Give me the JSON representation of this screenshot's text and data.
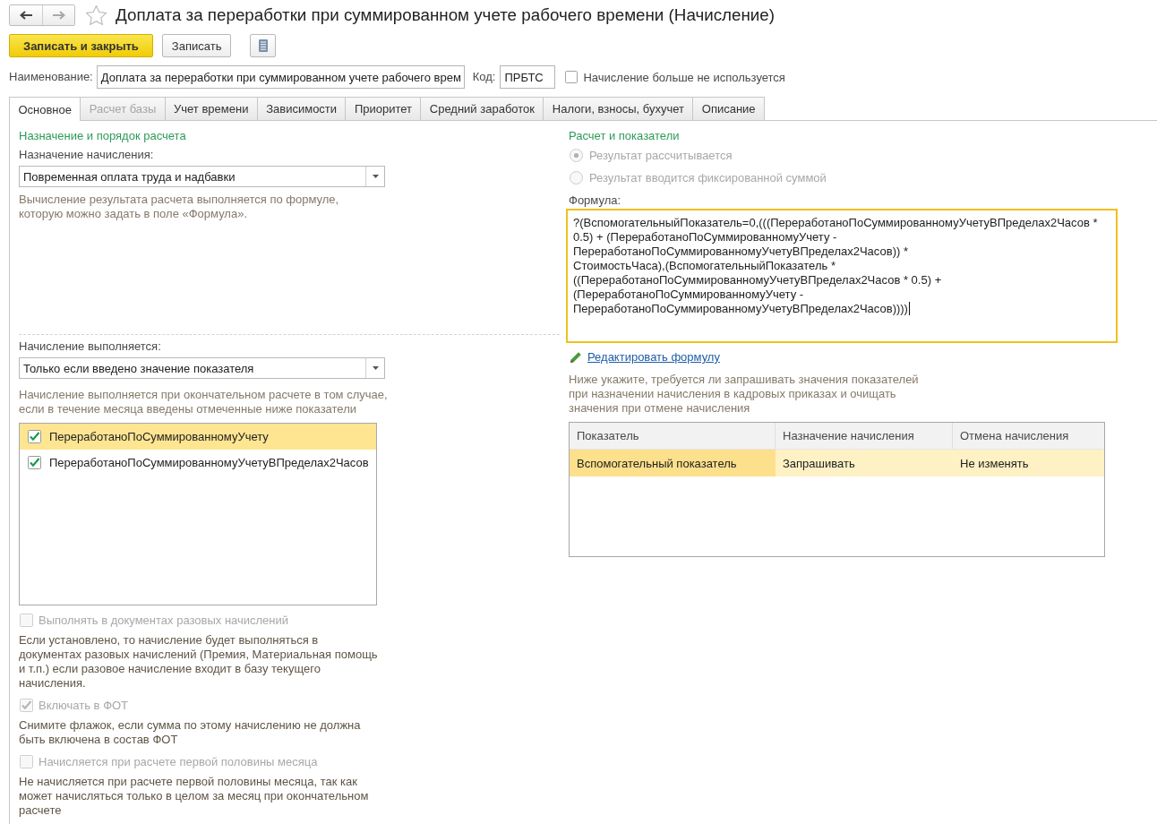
{
  "window": {
    "title": "Доплата за переработки при суммированном учете рабочего времени (Начисление)"
  },
  "navigation": [
    {
      "kind": "back",
      "disabled": false
    },
    {
      "kind": "forward",
      "disabled": true
    }
  ],
  "favorite": {
    "on": false
  },
  "toolbar": [
    {
      "kind": "primary",
      "label": "Записать и закрыть"
    },
    {
      "kind": "default",
      "label": "Записать"
    },
    {
      "kind": "icon"
    }
  ],
  "header": {
    "name": {
      "label": "Наименование:",
      "value": "Доплата за переработки при суммированном учете рабочего врем"
    },
    "code": {
      "label": "Код:",
      "value": "ПРБТС"
    },
    "not_used": {
      "label": "Начисление больше не используется",
      "checked": false
    }
  },
  "tabs": [
    {
      "label": "Основное",
      "selected": true,
      "disabled": false
    },
    {
      "label": "Расчет базы",
      "selected": false,
      "disabled": true
    },
    {
      "label": "Учет времени",
      "selected": false,
      "disabled": false
    },
    {
      "label": "Зависимости",
      "selected": false,
      "disabled": false
    },
    {
      "label": "Приоритет",
      "selected": false,
      "disabled": false
    },
    {
      "label": "Средний заработок",
      "selected": false,
      "disabled": false
    },
    {
      "label": "Налоги, взносы, бухучет",
      "selected": false,
      "disabled": false
    },
    {
      "label": "Описание",
      "selected": false,
      "disabled": false
    }
  ],
  "purpose_section": {
    "title": "Назначение и порядок расчета",
    "purpose": {
      "label": "Назначение начисления:",
      "value": "Повременная оплата труда и надбавки",
      "hint": "Вычисление результата расчета выполняется по формуле,\nкоторую можно задать в поле «Формула»."
    },
    "execution": {
      "label": "Начисление выполняется:",
      "value": "Только если введено значение показателя",
      "hint": "Начисление выполняется при окончательном расчете в том случае,\nесли в течение месяца введены отмеченные ниже показатели"
    },
    "indicators": [
      {
        "name": "ПереработаноПоСуммированномуУчету",
        "checked": true,
        "selected": true
      },
      {
        "name": "ПереработаноПоСуммированномуУчетуВПределах2Часов",
        "checked": true,
        "selected": false
      }
    ],
    "options": [
      {
        "label": "Выполнять в документах разовых начислений",
        "checked": false,
        "disabled": true,
        "hint": "Если установлено, то начисление будет выполняться в\nдокументах разовых начислений (Премия, Материальная помощь\nи т.п.) если разовое начисление входит в базу текущего\nначисления."
      },
      {
        "label": "Включать в ФОТ",
        "checked": true,
        "disabled": true,
        "hint": "Снимите флажок, если сумма по этому начислению не должна\nбыть включена в состав ФОТ"
      },
      {
        "label": "Начисляется при расчете первой половины месяца",
        "checked": false,
        "disabled": true,
        "hint": "Не начисляется при расчете первой половины месяца, так как\nможет начисляться только в целом за месяц при окончательном\nрасчете"
      }
    ]
  },
  "calculation_section": {
    "title": "Расчет и показатели",
    "result_modes": [
      {
        "label": "Результат рассчитывается",
        "selected": true,
        "disabled": true
      },
      {
        "label": "Результат вводится фиксированной суммой",
        "selected": false,
        "disabled": true
      }
    ],
    "formula": {
      "label": "Формула:",
      "value": "?(ВспомогательныйПоказатель=0,(((ПереработаноПоСуммированномуУчетуВПределах2Часов * 0.5) + (ПереработаноПоСуммированномуУчету - ПереработаноПоСуммированномуУчетуВПределах2Часов)) * СтоимостьЧаса),(ВспомогательныйПоказатель * ((ПереработаноПоСуммированномуУчетуВПределах2Часов * 0.5) + (ПереработаноПоСуммированномуУчету - ПереработаноПоСуммированномуУчетуВПределах2Часов))))",
      "focused": true
    },
    "edit_link": "Редактировать формулу",
    "hint": "Ниже укажите, требуется ли запрашивать значения показателей\nпри назначении начисления в кадровых приказах и очищать\nзначения при отмене начисления",
    "table": {
      "columns": [
        "Показатель",
        "Назначение начисления",
        "Отмена начисления"
      ],
      "rows": [
        {
          "cells": [
            "Вспомогательный показатель",
            "Запрашивать",
            "Не изменять"
          ],
          "selected": true
        }
      ]
    }
  }
}
